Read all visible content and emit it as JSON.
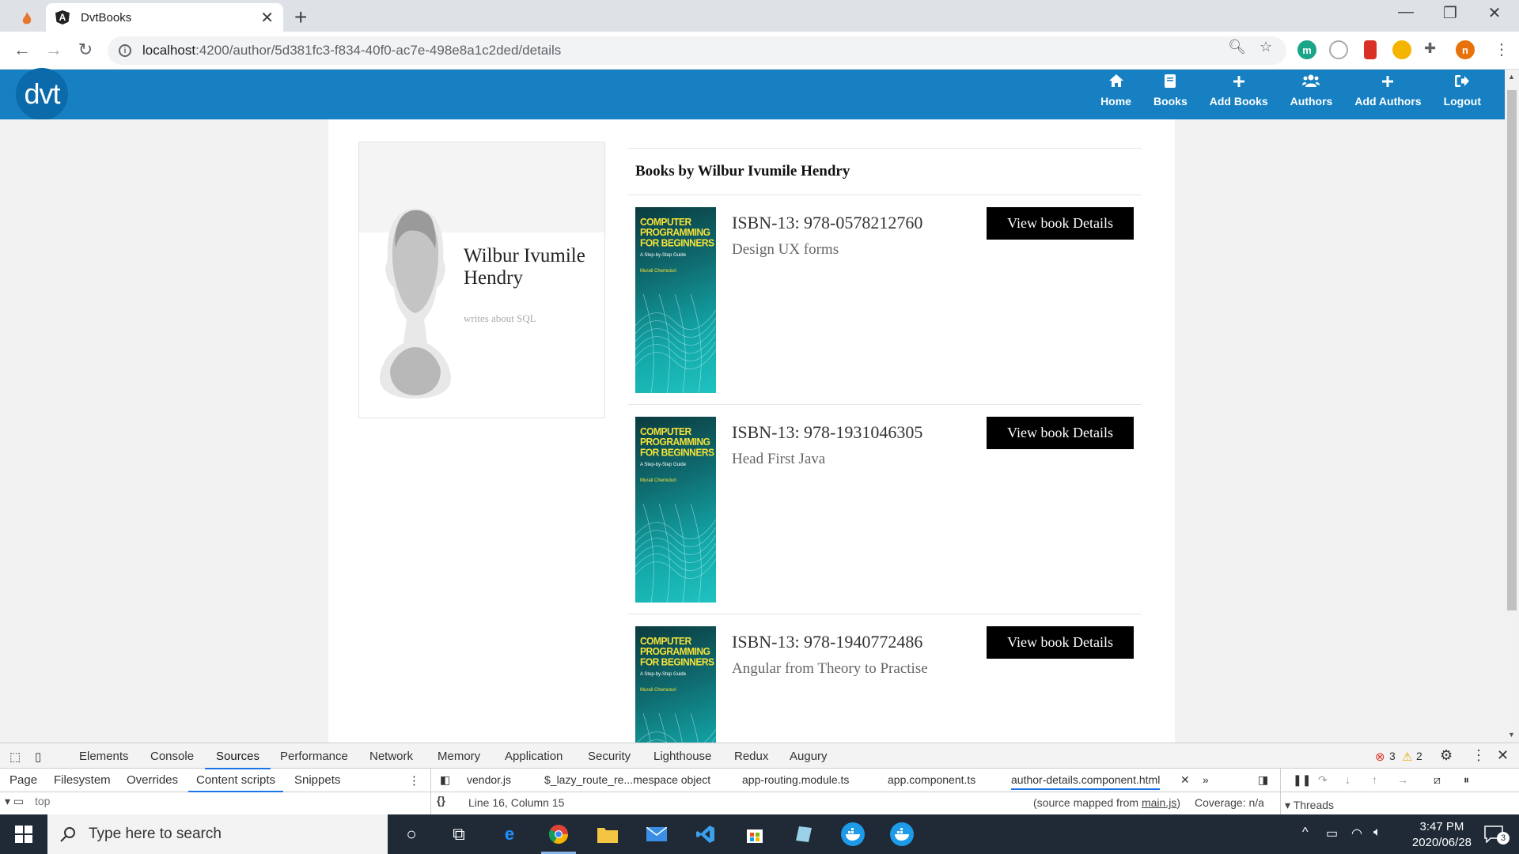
{
  "browser": {
    "tab_title": "DvtBooks",
    "url_host": "localhost",
    "url_path": ":4200/author/5d381fc3-f834-40f0-ac7e-498e8a1c2ded/details",
    "profile_initial": "n"
  },
  "navbar": {
    "logo": "dvt",
    "items": [
      {
        "label": "Home",
        "icon": "home-icon"
      },
      {
        "label": "Books",
        "icon": "book-icon"
      },
      {
        "label": "Add Books",
        "icon": "plus-icon"
      },
      {
        "label": "Authors",
        "icon": "users-icon"
      },
      {
        "label": "Add Authors",
        "icon": "plus-icon"
      },
      {
        "label": "Logout",
        "icon": "logout-icon"
      }
    ]
  },
  "author": {
    "name": "Wilbur Ivumile Hendry",
    "about": "writes about SQL"
  },
  "books_section": {
    "heading": "Books by Wilbur Ivumile Hendry",
    "button_label": "View book Details",
    "items": [
      {
        "isbn": "ISBN-13: 978-0578212760",
        "title": "Design UX forms"
      },
      {
        "isbn": "ISBN-13: 978-1931046305",
        "title": "Head First Java"
      },
      {
        "isbn": "ISBN-13: 978-1940772486",
        "title": "Angular from Theory to Practise"
      }
    ]
  },
  "devtools": {
    "tabs": [
      "Elements",
      "Console",
      "Sources",
      "Performance",
      "Network",
      "Memory",
      "Application",
      "Security",
      "Lighthouse",
      "Redux",
      "Augury"
    ],
    "active_tab": "Sources",
    "errors": "3",
    "warnings": "2",
    "nav_tabs": [
      "Page",
      "Filesystem",
      "Overrides",
      "Content scripts",
      "Snippets"
    ],
    "file_tabs": [
      "vendor.js",
      "$_lazy_route_re...mespace object",
      "app-routing.module.ts",
      "app.component.ts",
      "author-details.component.html"
    ],
    "frame": "top",
    "position": "Line 16, Column 15",
    "source_mapped": "(source mapped from ",
    "source_file": "main.js",
    "coverage": "Coverage: n/a",
    "threads": "Threads"
  },
  "taskbar": {
    "search_placeholder": "Type here to search",
    "time": "3:47 PM",
    "date": "2020/06/28",
    "notifications": "3"
  },
  "colors": {
    "navbar": "#1680c2",
    "button": "#000000",
    "accent": "#1a73e8"
  }
}
